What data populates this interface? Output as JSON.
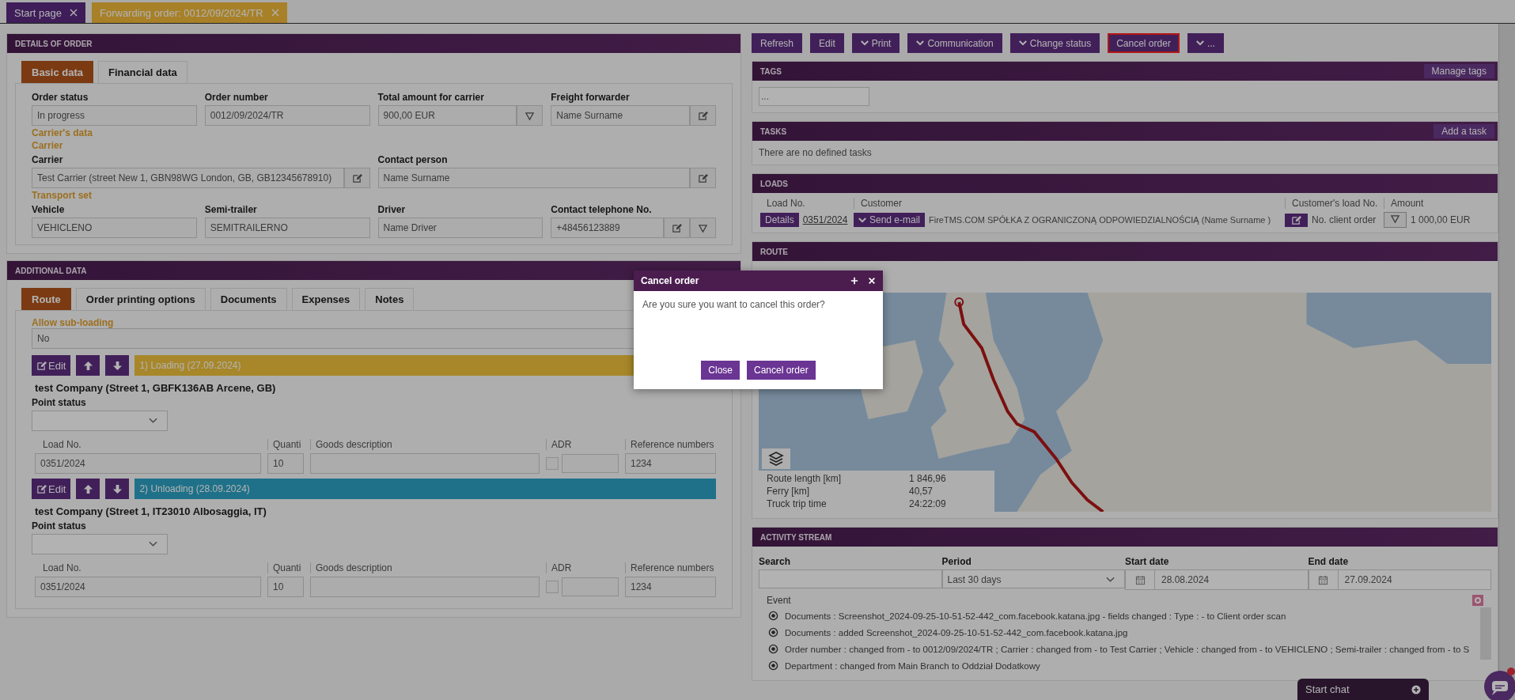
{
  "tabs": [
    {
      "label": "Start page",
      "selected": false
    },
    {
      "label": "Forwarding order: 0012/09/2024/TR",
      "selected": true
    }
  ],
  "details": {
    "title": "DETAILS OF ORDER",
    "tabs": [
      {
        "label": "Basic data",
        "selected": true
      },
      {
        "label": "Financial data",
        "selected": false
      }
    ],
    "groups": [
      {
        "fields": [
          {
            "label": "Order status",
            "value": "In progress"
          },
          {
            "label": "Order number",
            "value": "0012/09/2024/TR"
          },
          {
            "label": "Total amount for carrier",
            "value": "900,00 EUR",
            "filter_button": true
          },
          {
            "label": "Freight forwarder",
            "value": "Name Surname",
            "edit_button": true
          }
        ]
      },
      {
        "headings": [
          "Carrier's data",
          "Carrier"
        ],
        "fields": [
          {
            "label": "Carrier",
            "value": "Test Carrier (street New 1, GBN98WG London, GB, GB12345678910)",
            "edit_button": true
          },
          {
            "label": "Contact person",
            "value": "Name Surname",
            "edit_button": true
          }
        ]
      },
      {
        "headings": [
          "Transport set"
        ],
        "fields": [
          {
            "label": "Vehicle",
            "value": "VEHICLENO"
          },
          {
            "label": "Semi-trailer",
            "value": "SEMITRAILERNO"
          },
          {
            "label": "Driver",
            "value": "Name Driver"
          },
          {
            "label": "Contact telephone No.",
            "value": "+48456123889",
            "edit_button": true,
            "filter_button": true
          }
        ]
      }
    ]
  },
  "additional": {
    "title": "ADDITIONAL DATA",
    "tabs": [
      {
        "label": "Route",
        "selected": true
      },
      {
        "label": "Order printing options",
        "selected": false
      },
      {
        "label": "Documents",
        "selected": false
      },
      {
        "label": "Expenses",
        "selected": false
      },
      {
        "label": "Notes",
        "selected": false
      }
    ],
    "sub_loading": {
      "label": "Allow sub-loading",
      "value": "No"
    },
    "points": [
      {
        "edit": "Edit",
        "title": "1) Loading (27.09.2024)",
        "color": "#a8882a",
        "company": "test Company (Street 1, GBFK136AB Arcene, GB)",
        "status_label": "Point status",
        "columns": [
          "Load No.",
          "Quanti",
          "Goods description",
          "ADR",
          "Reference numbers"
        ],
        "load_no": "0351/2024",
        "quantity": "10",
        "adr": false,
        "reference": "1234"
      },
      {
        "edit": "Edit",
        "title": "2) Unloading (28.09.2024)",
        "color": "#1e7289",
        "company": "test Company (Street 1, IT23010 Albosaggia, IT)",
        "status_label": "Point status",
        "columns": [
          "Load No.",
          "Quanti",
          "Goods description",
          "ADR",
          "Reference numbers"
        ],
        "load_no": "0351/2024",
        "quantity": "10",
        "adr": false,
        "reference": "1234"
      }
    ]
  },
  "toolbar": [
    {
      "label": "Refresh",
      "dropdown": false,
      "focused": false
    },
    {
      "label": "Edit",
      "dropdown": false,
      "focused": false
    },
    {
      "label": "Print",
      "dropdown": true,
      "focused": false
    },
    {
      "label": "Communication",
      "dropdown": true,
      "focused": false
    },
    {
      "label": "Change status",
      "dropdown": true,
      "focused": false
    },
    {
      "label": "Cancel order",
      "dropdown": false,
      "focused": true
    },
    {
      "label": "...",
      "dropdown": true,
      "focused": false
    }
  ],
  "tags": {
    "title": "TAGS",
    "action": "Manage tags",
    "placeholder": "..."
  },
  "tasks": {
    "title": "TASKS",
    "action": "Add a task",
    "empty": "There are no defined tasks"
  },
  "loads": {
    "title": "LOADS",
    "columns": [
      "Load No.",
      "Customer",
      "Customer's load No.",
      "Amount"
    ],
    "rows": [
      {
        "details": "Details",
        "load_no": "0351/2024",
        "send": "Send e-mail",
        "customer": "FireTMS.COM SPÓŁKA Z OGRANICZONĄ ODPOWIEDZIALNOŚCIĄ (Name Surname )",
        "client_order": "No. client order",
        "amount": "1 000,00 EUR"
      }
    ]
  },
  "route": {
    "title": "ROUTE",
    "stats": [
      {
        "label": "Route length [km]",
        "value": "1 846,96"
      },
      {
        "label": "Ferry [km]",
        "value": "40,57"
      },
      {
        "label": "Truck trip time",
        "value": "24:22:09"
      }
    ]
  },
  "activity": {
    "title": "ACTIVITY STREAM",
    "filters": [
      {
        "kind": "text",
        "label": "Search"
      },
      {
        "kind": "select",
        "label": "Period",
        "value": "Last 30 days"
      },
      {
        "kind": "date",
        "label": "Start date",
        "value": "28.08.2024"
      },
      {
        "kind": "date",
        "label": "End date",
        "value": "27.09.2024"
      }
    ],
    "column": "Event",
    "events": [
      "Documents : Screenshot_2024-09-25-10-51-52-442_com.facebook.katana.jpg - fields changed : Type : - to Client order scan",
      "Documents : added Screenshot_2024-09-25-10-51-52-442_com.facebook.katana.jpg",
      "Order number : changed from - to 0012/09/2024/TR ; Carrier : changed from - to Test Carrier ; Vehicle : changed from - to VEHICLENO ; Semi-trailer : changed from - to S",
      "Department : changed from Main Branch to Oddział Dodatkowy"
    ]
  },
  "chat": {
    "label": "Start chat"
  },
  "dialog": {
    "title": "Cancel order",
    "message": "Are you sure you want to cancel this order?",
    "buttons": [
      "Close",
      "Cancel order"
    ]
  }
}
